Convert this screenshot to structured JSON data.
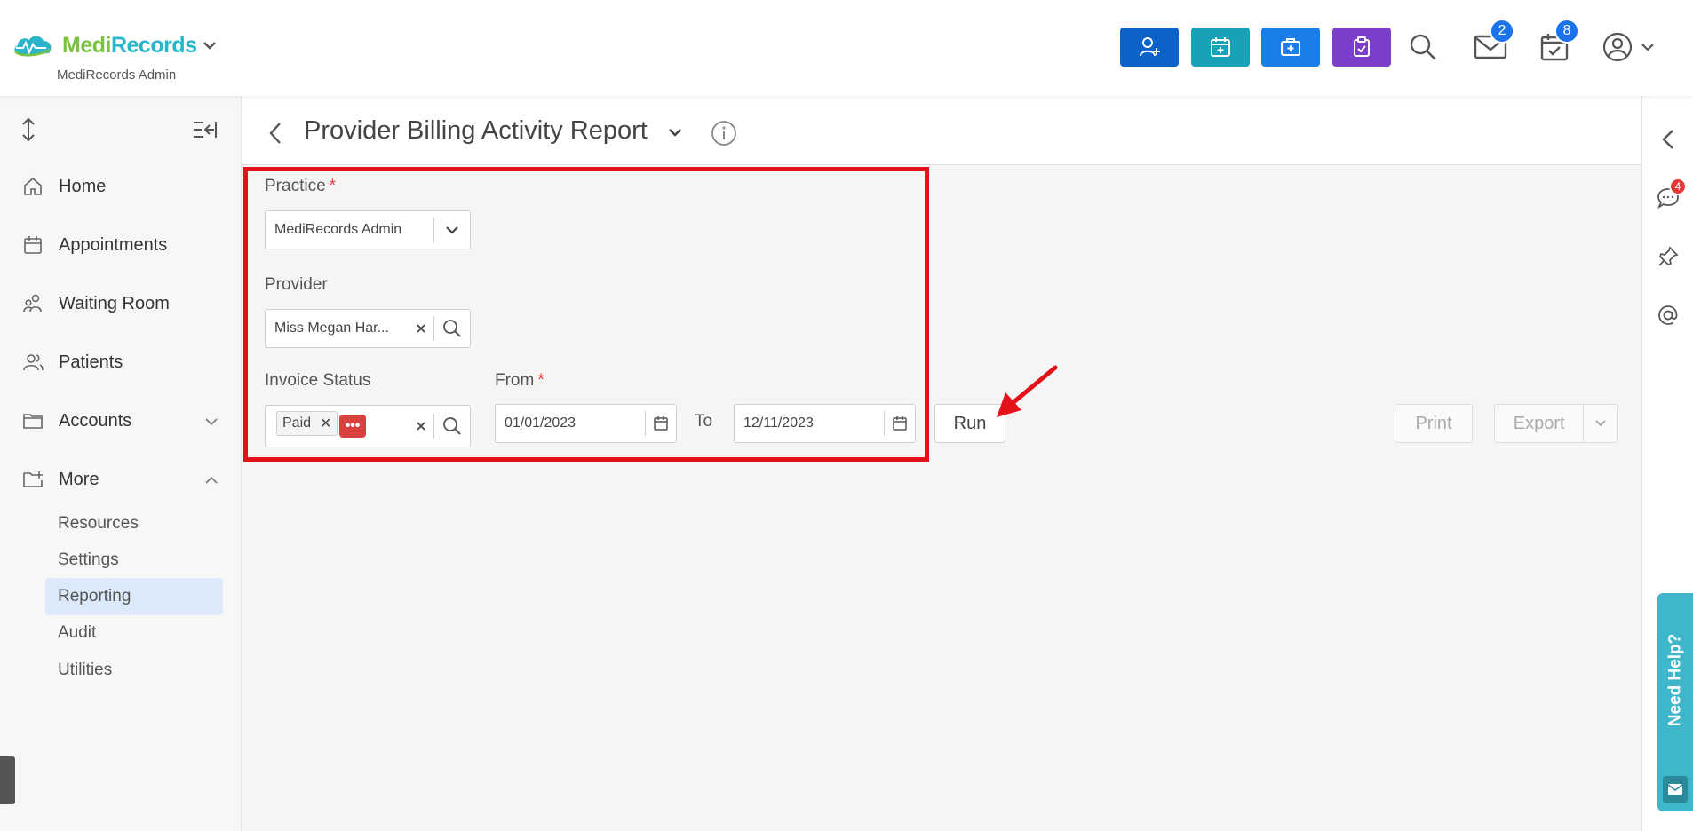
{
  "header": {
    "brand_part1": "Medi",
    "brand_part2": "Records",
    "practice_name": "MediRecords Admin",
    "quick_buttons": [
      {
        "icon": "add-patient-icon",
        "color": "#0b63c9"
      },
      {
        "icon": "add-appointment-icon",
        "color": "#17a2b8"
      },
      {
        "icon": "medical-kit-icon",
        "color": "#1a7ee8"
      },
      {
        "icon": "clipboard-check-icon",
        "color": "#7b3fc9"
      }
    ],
    "messages_badge": "2",
    "tasks_badge": "8"
  },
  "sidebar": {
    "items": [
      {
        "label": "Home",
        "icon": "home-icon"
      },
      {
        "label": "Appointments",
        "icon": "calendar-icon"
      },
      {
        "label": "Waiting Room",
        "icon": "waiting-room-icon"
      },
      {
        "label": "Patients",
        "icon": "patients-icon"
      },
      {
        "label": "Accounts",
        "icon": "folder-icon"
      },
      {
        "label": "More",
        "icon": "folder-plus-icon"
      }
    ],
    "sub_items": [
      {
        "label": "Resources"
      },
      {
        "label": "Settings"
      },
      {
        "label": "Reporting",
        "active": true
      },
      {
        "label": "Audit"
      },
      {
        "label": "Utilities"
      }
    ]
  },
  "report": {
    "title": "Provider Billing Activity Report",
    "practice_label": "Practice",
    "practice_value": "MediRecords Admin",
    "provider_label": "Provider",
    "provider_value": "Miss Megan Har...",
    "invoice_status_label": "Invoice Status",
    "invoice_status_tag": "Paid",
    "more_pill": "•••",
    "from_label": "From",
    "from_value": "01/01/2023",
    "to_label": "To",
    "to_value": "12/11/2023",
    "run_label": "Run",
    "print_label": "Print",
    "export_label": "Export",
    "required_mark": "*"
  },
  "right_rail": {
    "chat_badge": "4",
    "help_label": "Need Help?"
  },
  "colors": {
    "accent": "#1a73e8",
    "highlight": "#e3111a",
    "active_nav": "#dbe9f9",
    "help": "#3fb6c9"
  }
}
